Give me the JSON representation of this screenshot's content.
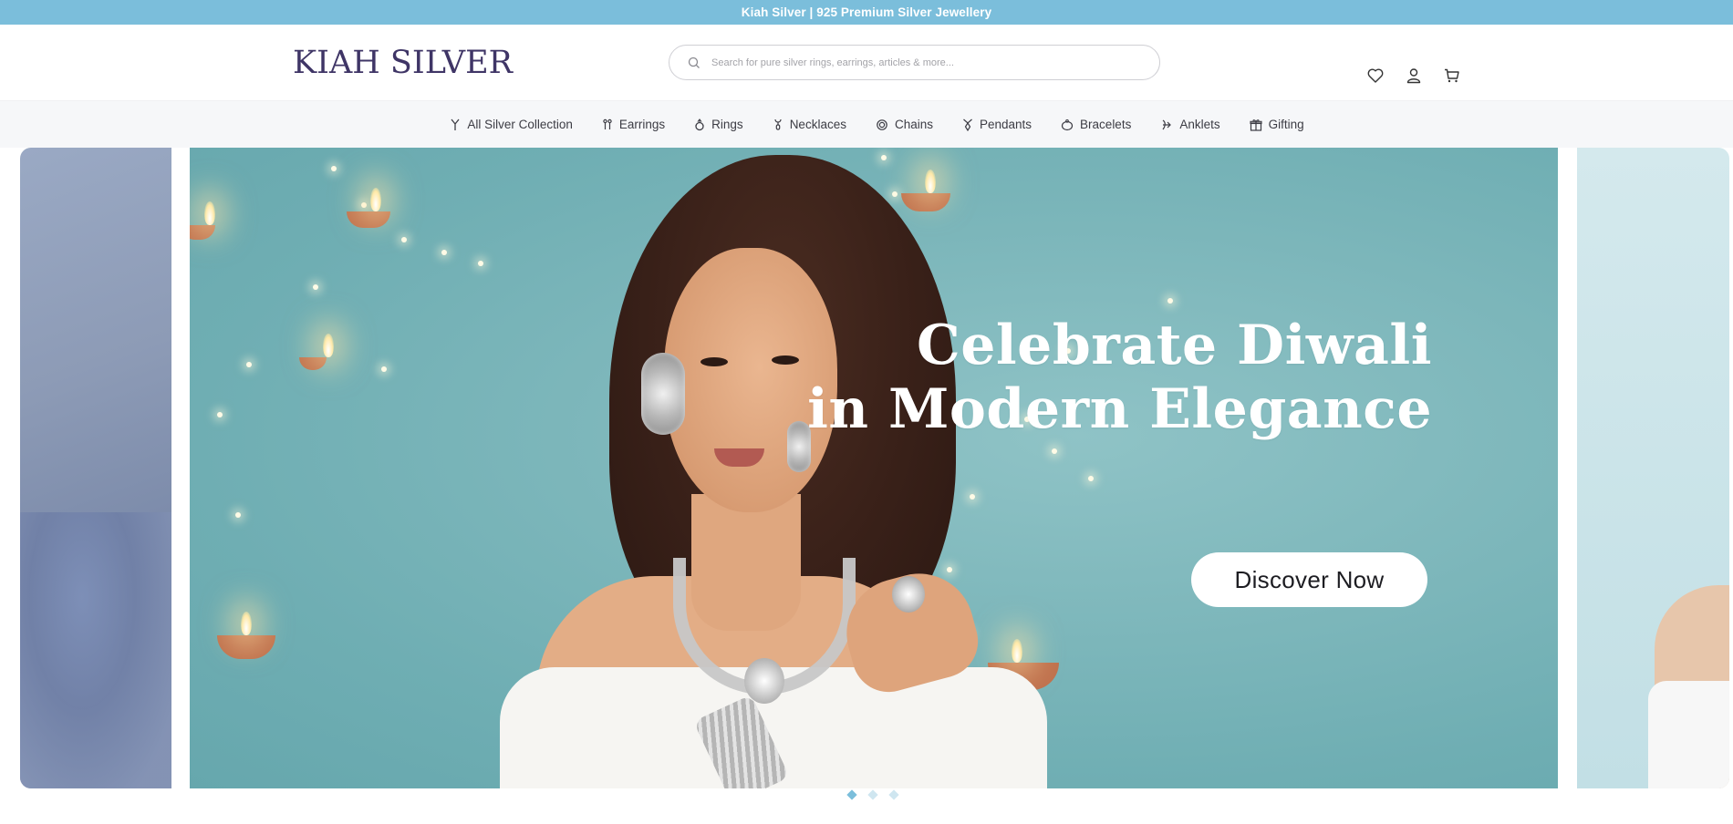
{
  "announcement": {
    "text": "Kiah Silver | 925 Premium Silver Jewellery"
  },
  "header": {
    "logo_text": "KIAH SILVER",
    "search": {
      "placeholder": "Search for pure silver rings, earrings, articles & more...",
      "value": ""
    },
    "icons": [
      "heart-icon",
      "user-icon",
      "cart-icon"
    ]
  },
  "categories": [
    {
      "label": "All Silver Collection",
      "icon": "wine-glass-icon"
    },
    {
      "label": "Earrings",
      "icon": "earrings-icon"
    },
    {
      "label": "Rings",
      "icon": "ring-icon"
    },
    {
      "label": "Necklaces",
      "icon": "necklace-icon"
    },
    {
      "label": "Chains",
      "icon": "chain-icon"
    },
    {
      "label": "Pendants",
      "icon": "pendant-icon"
    },
    {
      "label": "Bracelets",
      "icon": "bracelet-icon"
    },
    {
      "label": "Anklets",
      "icon": "anklet-icon"
    },
    {
      "label": "Gifting",
      "icon": "gift-icon"
    }
  ],
  "hero": {
    "headline_line1": "Celebrate Diwali",
    "headline_line2": "in Modern Elegance",
    "cta_label": "Discover Now",
    "slide_count": 3,
    "active_slide": 1
  },
  "colors": {
    "announcement_bg": "#7bbedb",
    "logo": "#3f3566",
    "hero_bg": "#7fb8bc",
    "dot_active": "#7bbedb",
    "dot_inactive": "#cfe6f0"
  }
}
